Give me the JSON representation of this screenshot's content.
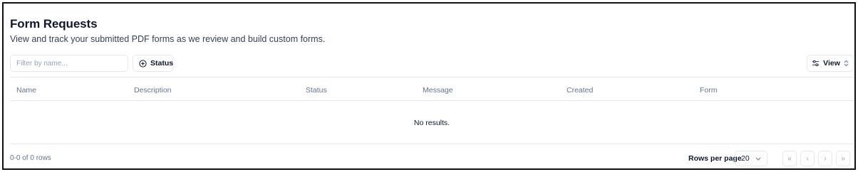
{
  "header": {
    "title": "Form Requests",
    "subtitle": "View and track your submitted PDF forms as we review and build custom forms."
  },
  "toolbar": {
    "filter_placeholder": "Filter by name...",
    "filter_value": "",
    "status_label": "Status",
    "view_label": "View"
  },
  "table": {
    "columns": [
      "Name",
      "Description",
      "Status",
      "Message",
      "Created",
      "Form"
    ],
    "empty_text": "No results."
  },
  "footer": {
    "row_count": "0-0 of 0 rows",
    "rows_per_page_label": "Rows per page",
    "rows_per_page_value": "20"
  },
  "icons": {
    "status": "plus-circle-icon",
    "view": "sliders-icon",
    "view_sort": "chevron-updown-icon",
    "rpp_caret": "chevron-down-icon",
    "first": "double-chevron-left-icon",
    "prev": "chevron-left-icon",
    "next": "chevron-right-icon",
    "last": "double-chevron-right-icon"
  }
}
